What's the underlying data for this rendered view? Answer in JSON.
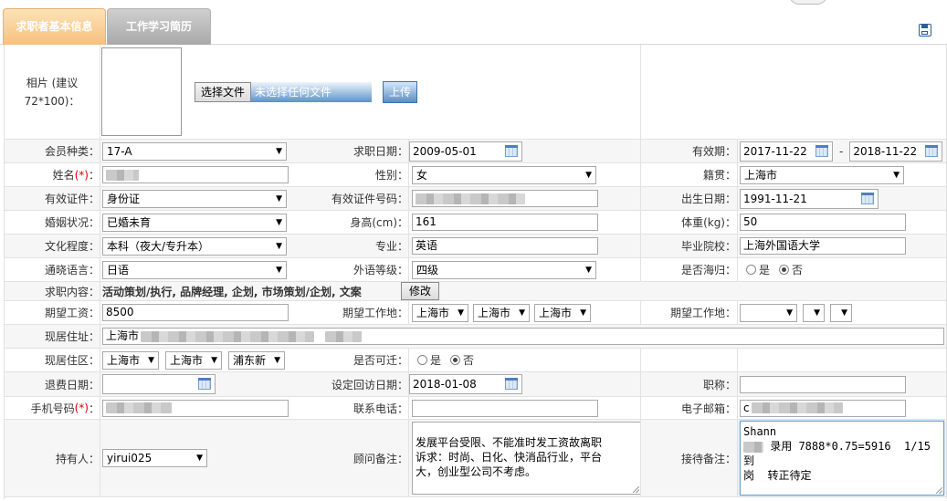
{
  "tabs": [
    {
      "label": "求职者基本信息",
      "active": true
    },
    {
      "label": "工作学习简历",
      "active": false
    }
  ],
  "photo": {
    "label": "相片 (建议72*100)：",
    "choose_button": "选择文件",
    "file_status": "未选择任何文件",
    "upload_button": "上传"
  },
  "row1": {
    "member_type_label": "会员种类：",
    "member_type_value": "17-A",
    "job_date_label": "求职日期：",
    "job_date_value": "2009-05-01",
    "valid_label": "有效期：",
    "valid_from": "2017-11-22",
    "valid_sep": "-",
    "valid_to": "2018-11-22"
  },
  "row2": {
    "name_label": "姓名",
    "req_mark": "(*)",
    "colon": "：",
    "gender_label": "性别：",
    "gender_value": "女",
    "native_label": "籍贯：",
    "native_value": "上海市"
  },
  "row3": {
    "id_type_label": "有效证件：",
    "id_type_value": "身份证",
    "id_no_label": "有效证件号码：",
    "birth_label": "出生日期：",
    "birth_value": "1991-11-21"
  },
  "row4": {
    "marital_label": "婚姻状况：",
    "marital_value": "已婚未育",
    "height_label": "身高(cm)：",
    "height_value": "161",
    "weight_label": "体重(kg)：",
    "weight_value": "50"
  },
  "row5": {
    "edu_label": "文化程度：",
    "edu_value": "本科（夜大/专升本）",
    "major_label": "专业：",
    "major_value": "英语",
    "school_label": "毕业院校：",
    "school_value": "上海外国语大学"
  },
  "row6": {
    "lang_label": "通晓语言：",
    "lang_value": "日语",
    "lang_level_label": "外语等级：",
    "lang_level_value": "四级",
    "overseas_label": "是否海归：",
    "yes": "是",
    "no": "否"
  },
  "row7": {
    "content_label": "求职内容：",
    "content_value": "活动策划/执行, 品牌经理, 企划, 市场策划/企划, 文案",
    "modify_button": "修改"
  },
  "row8": {
    "salary_label": "期望工资：",
    "salary_value": "8500",
    "place_label": "期望工作地：",
    "place1": "上海市",
    "place2": "上海市",
    "place3": "上海市",
    "place_label2": "期望工作地："
  },
  "row9": {
    "address_label": "现居住址：",
    "address_value": "上海市"
  },
  "row10": {
    "district_label": "现居住区：",
    "d1": "上海市",
    "d2": "上海市",
    "d3": "浦东新",
    "move_label": "是否可迁：",
    "yes": "是",
    "no": "否"
  },
  "row11": {
    "refund_label": "退费日期：",
    "visit_label": "设定回访日期：",
    "visit_value": "2018-01-08",
    "title_label": "职称："
  },
  "row12": {
    "mobile_label": "手机号码",
    "req_mark": "(*)",
    "colon": "：",
    "phone_label": "联系电话：",
    "email_label": "电子邮箱：",
    "email_prefix": "c"
  },
  "row13": {
    "owner_label": "持有人：",
    "owner_value": "yirui025",
    "advisor_label": "顾问备注：",
    "advisor_note": "发展平台受限、不能准时发工资故离职\n诉求：时尚、日化、快消品行业，平台\n大，创业型公司不考虑。",
    "reception_label": "接待备注：",
    "reception_line1": "Shann",
    "reception_line2": "录用 7888*0.75=5916  1/15到",
    "reception_line3": "岗  转正待定"
  }
}
